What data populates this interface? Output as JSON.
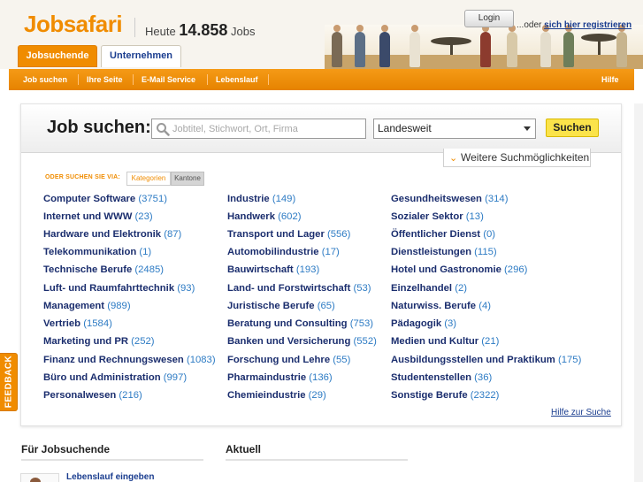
{
  "header": {
    "logo": "Jobsafari",
    "heute_label": "Heute",
    "job_count": "14.858",
    "jobs_label": "Jobs",
    "login_label": "Login",
    "register_prefix": "...oder",
    "register_link": "sich hier registrieren",
    "tabs": [
      {
        "label": "Jobsuchende",
        "active": true
      },
      {
        "label": "Unternehmen",
        "active": false
      }
    ]
  },
  "nav": {
    "items": [
      "Job suchen",
      "Ihre Seite",
      "E-Mail Service",
      "Lebenslauf"
    ],
    "help": "Hilfe"
  },
  "search": {
    "title": "Job suchen:",
    "placeholder": "Jobtitel, Stichwort, Ort, Firma",
    "location": "Landesweit",
    "button": "Suchen",
    "more_options": "Weitere Suchmöglichkeiten",
    "oder_label": "ODER SUCHEN SIE VIA:",
    "filter_tabs": [
      "Kategorien",
      "Kantone"
    ],
    "help_link": "Hilfe zur Suche"
  },
  "categories": {
    "col1": [
      {
        "name": "Computer Software",
        "count": "(3751)"
      },
      {
        "name": "Internet und WWW",
        "count": "(23)"
      },
      {
        "name": "Hardware und Elektronik",
        "count": "(87)"
      },
      {
        "name": "Telekommunikation",
        "count": "(1)"
      },
      {
        "name": "Technische Berufe",
        "count": "(2485)"
      },
      {
        "name": "Luft- und Raumfahrttechnik",
        "count": "(93)"
      },
      {
        "name": "Management",
        "count": "(989)"
      },
      {
        "name": "Vertrieb",
        "count": "(1584)"
      },
      {
        "name": "Marketing und PR",
        "count": "(252)"
      },
      {
        "name": "Finanz und Rechnungswesen",
        "count": "(1083)"
      },
      {
        "name": "Büro und Administration",
        "count": "(997)"
      },
      {
        "name": "Personalwesen",
        "count": "(216)"
      }
    ],
    "col2": [
      {
        "name": "Industrie",
        "count": "(149)"
      },
      {
        "name": "Handwerk",
        "count": "(602)"
      },
      {
        "name": "Transport und Lager",
        "count": "(556)"
      },
      {
        "name": "Automobilindustrie",
        "count": "(17)"
      },
      {
        "name": "Bauwirtschaft",
        "count": "(193)"
      },
      {
        "name": "Land- und Forstwirtschaft",
        "count": "(53)"
      },
      {
        "name": "Juristische Berufe",
        "count": "(65)"
      },
      {
        "name": "Beratung und Consulting",
        "count": "(753)"
      },
      {
        "name": "Banken und Versicherung",
        "count": "(552)"
      },
      {
        "name": "Forschung und Lehre",
        "count": "(55)"
      },
      {
        "name": "Pharmaindustrie",
        "count": "(136)"
      },
      {
        "name": "Chemieindustrie",
        "count": "(29)"
      }
    ],
    "col3": [
      {
        "name": "Gesundheitswesen",
        "count": "(314)"
      },
      {
        "name": "Sozialer Sektor",
        "count": "(13)"
      },
      {
        "name": "Öffentlicher Dienst",
        "count": "(0)"
      },
      {
        "name": "Dienstleistungen",
        "count": "(115)"
      },
      {
        "name": "Hotel und Gastronomie",
        "count": "(296)"
      },
      {
        "name": "Einzelhandel",
        "count": "(2)"
      },
      {
        "name": "Naturwiss. Berufe",
        "count": "(4)"
      },
      {
        "name": "Pädagogik",
        "count": "(3)"
      },
      {
        "name": "Medien und Kultur",
        "count": "(21)"
      },
      {
        "name": "Ausbildungsstellen und Praktikum",
        "count": "(175)"
      },
      {
        "name": "Studentenstellen",
        "count": "(36)"
      },
      {
        "name": "Sonstige Berufe",
        "count": "(2322)"
      }
    ]
  },
  "lower": {
    "left_title": "Für Jobsuchende",
    "right_title": "Aktuell",
    "lebenslauf": "Lebenslauf eingeben"
  },
  "feedback": "FEEDBACK",
  "colors": {
    "accent": "#f08c00",
    "link": "#1b2e6e",
    "count": "#2d7bc4",
    "button": "#fbe34a"
  }
}
